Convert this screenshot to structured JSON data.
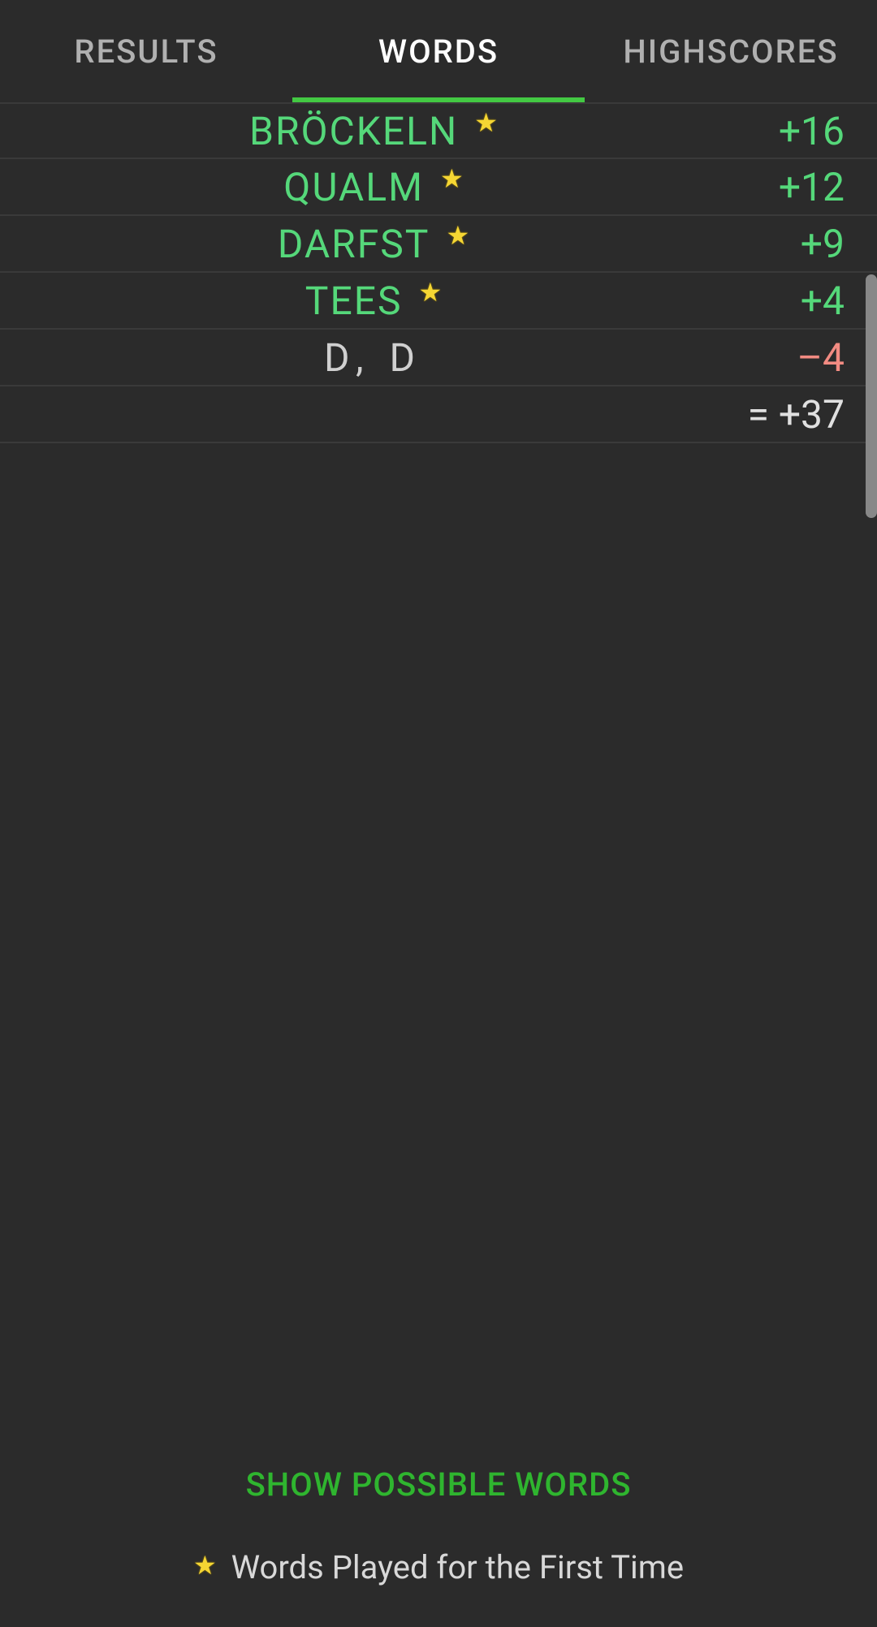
{
  "tabs": {
    "results": "RESULTS",
    "words": "WORDS",
    "highscores": "HIGHSCORES",
    "active": "words"
  },
  "words": [
    {
      "text": "BRÖCKELN",
      "star": true,
      "score": "+16",
      "valid": true
    },
    {
      "text": "QUALM",
      "star": true,
      "score": "+12",
      "valid": true
    },
    {
      "text": "DARFST",
      "star": true,
      "score": "+9",
      "valid": true
    },
    {
      "text": "TEES",
      "star": true,
      "score": "+4",
      "valid": true
    },
    {
      "text": "D, D",
      "star": false,
      "score": "–4",
      "valid": false
    }
  ],
  "total": "= +37",
  "actions": {
    "show_possible": "SHOW POSSIBLE WORDS"
  },
  "legend": {
    "text": "Words Played for the First Time"
  },
  "icons": {
    "star": "★"
  }
}
